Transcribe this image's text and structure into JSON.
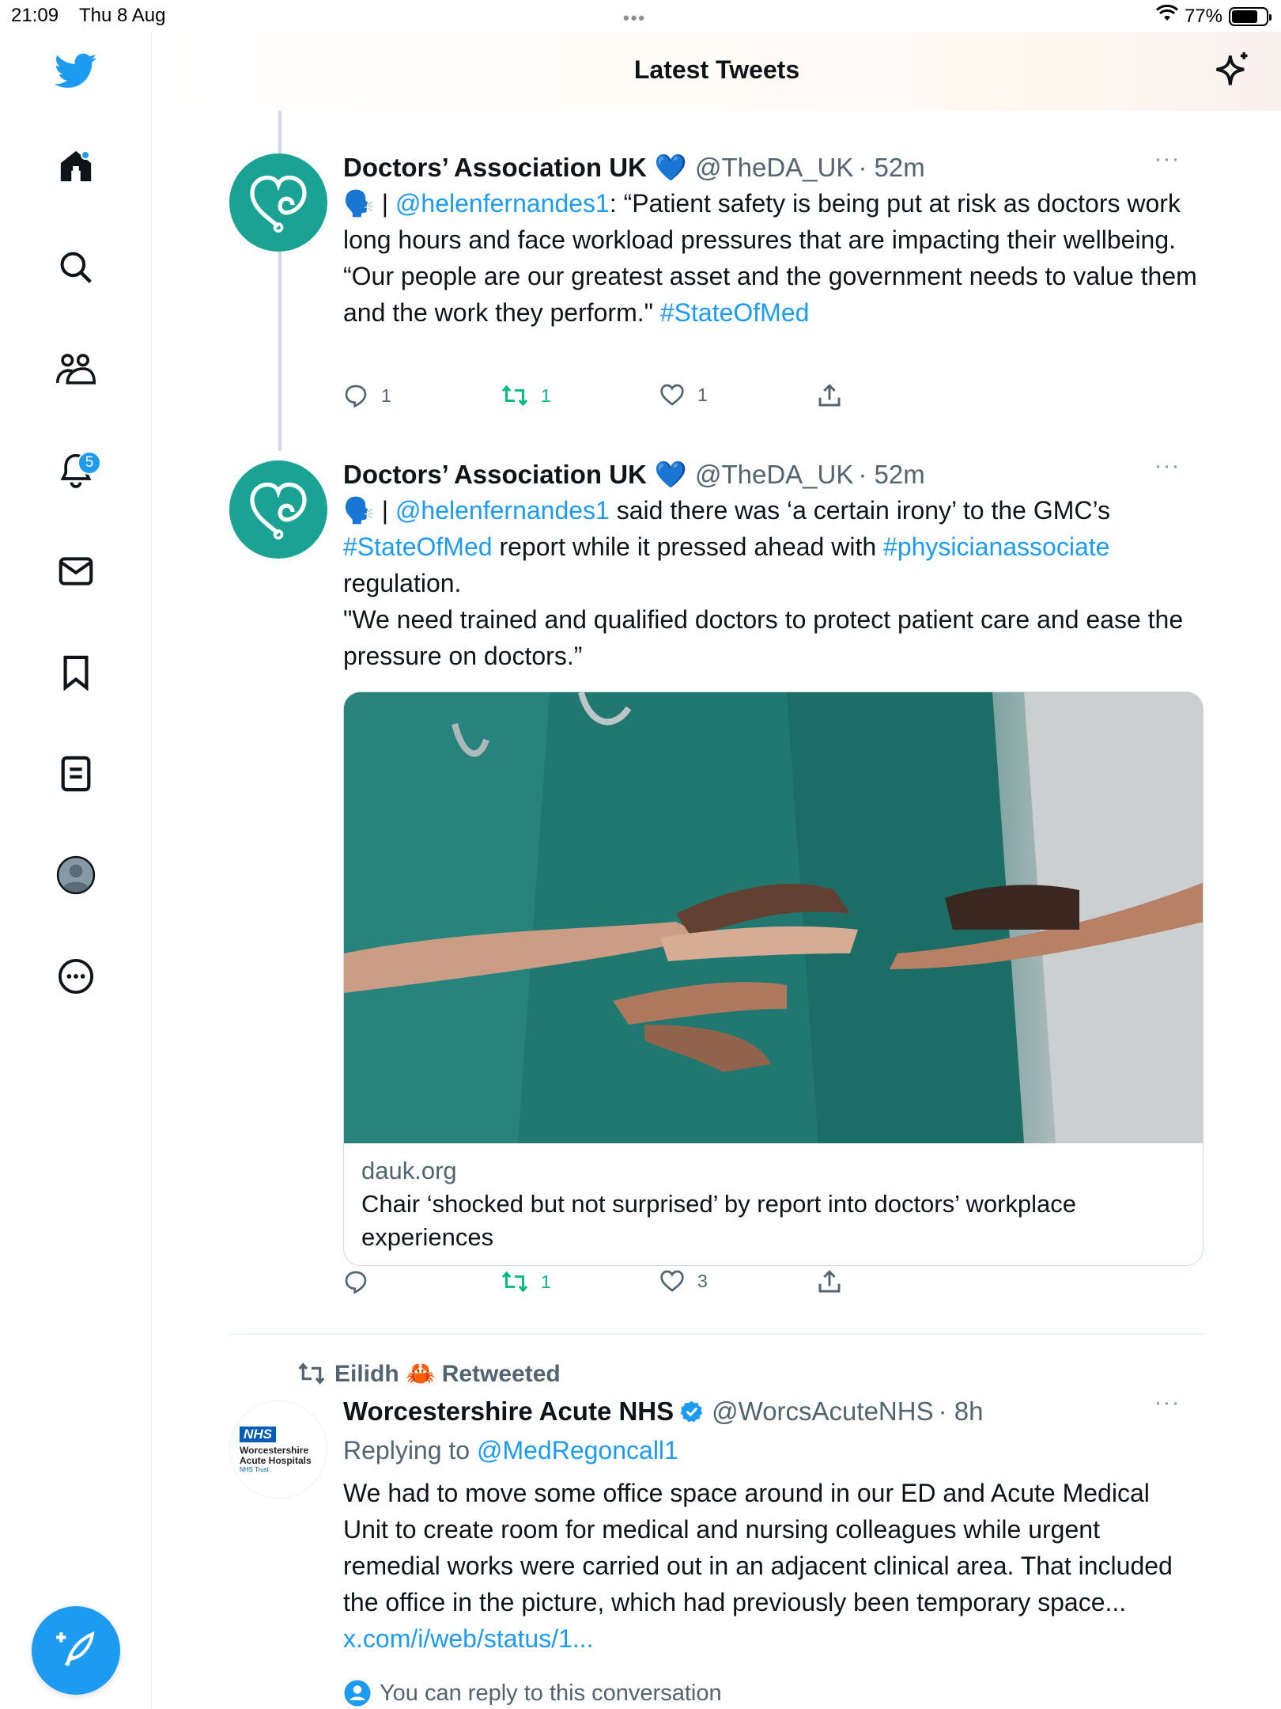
{
  "status_bar": {
    "time": "21:09",
    "date": "Thu 8 Aug",
    "battery": "77%",
    "battery_level": 0.77
  },
  "header": {
    "title": "Latest Tweets"
  },
  "sidebar": {
    "items": [
      {
        "icon": "home-icon",
        "label": "Home"
      },
      {
        "icon": "search-icon",
        "label": "Search"
      },
      {
        "icon": "communities-icon",
        "label": "Communities"
      },
      {
        "icon": "bell-icon",
        "label": "Notifications",
        "badge": "5"
      },
      {
        "icon": "mail-icon",
        "label": "Messages"
      },
      {
        "icon": "bookmark-icon",
        "label": "Bookmarks"
      },
      {
        "icon": "list-icon",
        "label": "Lists"
      },
      {
        "icon": "profile-icon",
        "label": "Profile"
      },
      {
        "icon": "more-icon",
        "label": "More"
      }
    ],
    "fab_icon": "compose-tweet-icon"
  },
  "tweets": [
    {
      "name": "Doctors’ Association UK",
      "verified_emoji": "💙",
      "handle": "@TheDA_UK",
      "time": "· 52m",
      "mention_prefix": "🗣️ | ",
      "mention": "@helenfernandes1",
      "text_1": ":  “Patient safety is being put at risk as doctors work long hours and face workload pressures that are impacting their wellbeing.",
      "text_2": "“Our people are our greatest asset and the government needs to value them and the work they perform.\" ",
      "hashtag": "#StateOfMed",
      "replies": "1",
      "retweets": "1",
      "likes": "1"
    },
    {
      "name": "Doctors’ Association UK",
      "verified_emoji": "💙",
      "handle": "@TheDA_UK",
      "time": "· 52m",
      "mention_prefix": "🗣️ | ",
      "mention": "@helenfernandes1",
      "text_1": " said there was ‘a certain irony’ to the GMC’s ",
      "hashtag_1": "#StateOfMed",
      "text_2": " report while it pressed ahead with ",
      "hashtag_2": "#physicianassociate",
      "text_3": " regulation.",
      "text_4": "\"We need trained and qualified doctors to protect patient care and ease the pressure on doctors.”",
      "card": {
        "domain": "dauk.org",
        "title": "Chair ‘shocked but not surprised’ by report into doctors’ workplace experiences"
      },
      "retweets": "1",
      "likes": "3"
    },
    {
      "retweeted_by": "Eilidh 🦀 Retweeted",
      "name": "Worcestershire Acute NHS",
      "handle": "@WorcsAcuteNHS",
      "time": "· 8h",
      "replying_label": "Replying to ",
      "replying_to": "@MedRegoncall1",
      "avatar_logo": {
        "nhs": "NHS",
        "line1": "Worcestershire",
        "line2": "Acute Hospitals",
        "line3": "NHS Trust"
      },
      "text": "We had to move some office space around in our ED and Acute Medical Unit to create room for medical and nursing colleagues while urgent remedial works were carried out in an adjacent clinical area. That included the office in the picture, which had previously been temporary space... ",
      "link": "x.com/i/web/status/1...",
      "reply_note": "You can reply to this conversation"
    }
  ],
  "colors": {
    "accent": "#1d9bf0",
    "retweet_green": "#00ba7c",
    "avatar_teal": "#1aa394",
    "nhs_blue": "#005eb8"
  }
}
